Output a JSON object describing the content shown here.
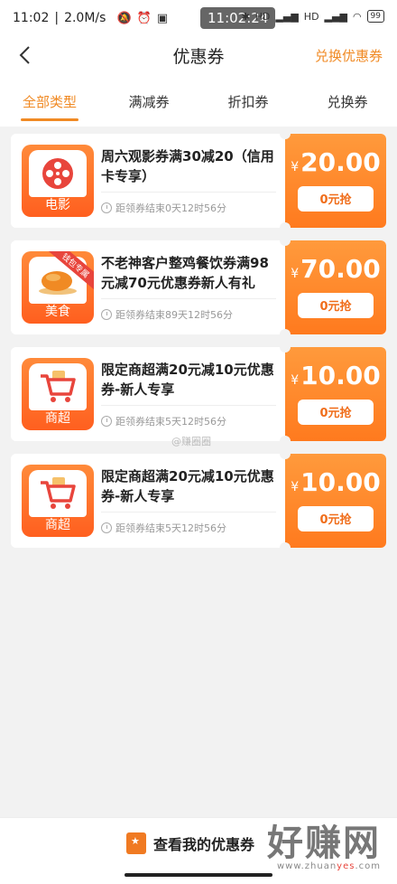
{
  "status_bar": {
    "time": "11:02",
    "speed": "2.0M/s",
    "time_pill": "11:02:24",
    "battery": "99",
    "signal_1": "HD",
    "signal_2": "HD"
  },
  "nav": {
    "title": "优惠券",
    "action": "兑换优惠券"
  },
  "tabs": [
    {
      "label": "全部类型",
      "active": true
    },
    {
      "label": "满减券",
      "active": false
    },
    {
      "label": "折扣券",
      "active": false
    },
    {
      "label": "兑换券",
      "active": false
    }
  ],
  "coupons": [
    {
      "category": "电影",
      "icon": "film-reel-icon",
      "title": "周六观影券满30减20（信用卡专享）",
      "deadline": "距领券结束0天12时56分",
      "currency": "¥",
      "amount": "20.00",
      "button": "0元抢"
    },
    {
      "category": "美食",
      "icon": "roast-chicken-icon",
      "ribbon": "钱包专属",
      "title": "不老神客户整鸡餐饮券满98元减70元优惠券新人有礼",
      "deadline": "距领券结束89天12时56分",
      "currency": "¥",
      "amount": "70.00",
      "button": "0元抢"
    },
    {
      "category": "商超",
      "icon": "shopping-cart-icon",
      "title": "限定商超满20元减10元优惠券-新人专享",
      "deadline": "距领券结束5天12时56分",
      "currency": "¥",
      "amount": "10.00",
      "button": "0元抢"
    },
    {
      "category": "商超",
      "icon": "shopping-cart-icon",
      "title": "限定商超满20元减10元优惠券-新人专享",
      "deadline": "距领券结束5天12时56分",
      "currency": "¥",
      "amount": "10.00",
      "button": "0元抢"
    }
  ],
  "watermark_mid": "@赚圈圈",
  "bottom": {
    "label": "查看我的优惠券"
  },
  "brand_watermark": {
    "big": "好赚网",
    "url_a": "www.zhuan",
    "url_b": "yes",
    "url_c": ".com"
  },
  "colors": {
    "accent": "#f08a24",
    "stub": "#ff7a1e"
  }
}
